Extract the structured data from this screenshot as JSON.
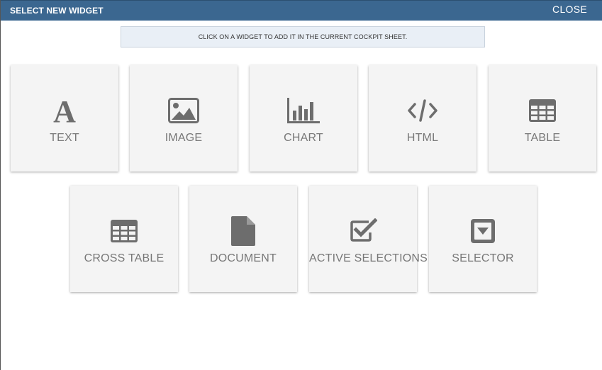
{
  "dialog": {
    "title": "SELECT NEW WIDGET",
    "close_label": "CLOSE",
    "info_text": "CLICK ON A WIDGET TO ADD IT IN THE CURRENT COCKPIT SHEET."
  },
  "colors": {
    "header": "#3b6790",
    "card": "#f4f4f4",
    "icon": "#6d6d6d",
    "label": "#777777"
  },
  "widgets": [
    {
      "label": "TEXT",
      "icon": "text-icon"
    },
    {
      "label": "IMAGE",
      "icon": "image-icon"
    },
    {
      "label": "CHART",
      "icon": "chart-icon"
    },
    {
      "label": "HTML",
      "icon": "code-icon"
    },
    {
      "label": "TABLE",
      "icon": "table-icon"
    },
    {
      "label": "CROSS TABLE",
      "icon": "cross-table-icon"
    },
    {
      "label": "DOCUMENT",
      "icon": "document-icon"
    },
    {
      "label": "ACTIVE SELECTIONS",
      "icon": "checkbox-icon"
    },
    {
      "label": "SELECTOR",
      "icon": "selector-icon"
    }
  ]
}
